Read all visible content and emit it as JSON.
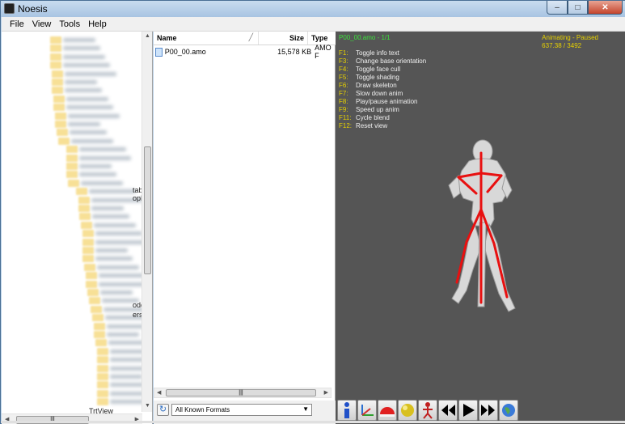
{
  "window": {
    "title": "Noesis"
  },
  "menu": [
    "File",
    "View",
    "Tools",
    "Help"
  ],
  "tree": {
    "visible_fragments": [
      "tab",
      "opF",
      "ode",
      "ers",
      "TrtView"
    ]
  },
  "file_list": {
    "columns": {
      "name": "Name",
      "size": "Size",
      "type": "Type"
    },
    "rows": [
      {
        "name": "P00_00.amo",
        "size": "15,578 KB",
        "type": "AMO F"
      }
    ]
  },
  "format_filter": {
    "selected": "All Known Formats"
  },
  "viewport": {
    "file_info": "P00_00.amo - 1/1",
    "status": "Animating - Paused",
    "frame": "637.38 / 3492",
    "shortcuts": [
      {
        "key": "F1:",
        "action": "Toggle info text"
      },
      {
        "key": "F3:",
        "action": "Change base orientation"
      },
      {
        "key": "F4:",
        "action": "Toggle face cull"
      },
      {
        "key": "F5:",
        "action": "Toggle shading"
      },
      {
        "key": "F6:",
        "action": "Draw skeleton"
      },
      {
        "key": "F7:",
        "action": "Slow down anim"
      },
      {
        "key": "F8:",
        "action": "Play/pause animation"
      },
      {
        "key": "F9:",
        "action": "Speed up anim"
      },
      {
        "key": "F11:",
        "action": "Cycle blend"
      },
      {
        "key": "F12:",
        "action": "Reset view"
      }
    ]
  },
  "toolbar_icons": [
    "info-icon",
    "axes-icon",
    "dome-icon",
    "sphere-icon",
    "skeleton-icon",
    "rewind-icon",
    "play-icon",
    "fast-forward-icon",
    "globe-icon"
  ],
  "colors": {
    "viewport_bg": "#555555",
    "status_yellow": "#e8d200",
    "file_green": "#3ce13c",
    "skeleton_red": "#e81010"
  }
}
